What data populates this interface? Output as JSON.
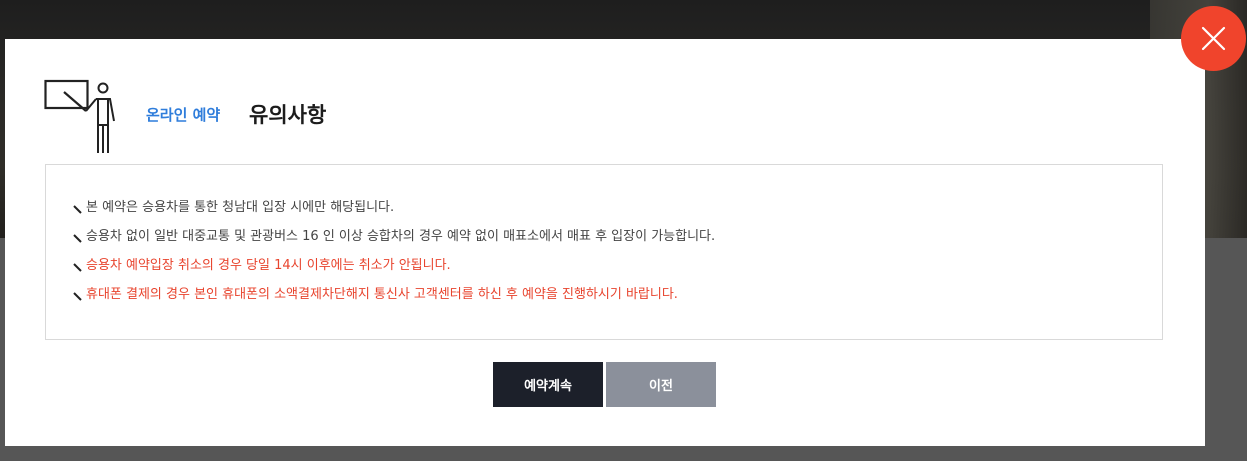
{
  "modal": {
    "title_sub": "온라인 예약",
    "title_main": "유의사항",
    "notices": [
      {
        "text": "본 예약은 승용차를 통한 청남대 입장 시에만 해당됩니다.",
        "highlight": false
      },
      {
        "text": "승용차 없이 일반 대중교통 및 관광버스 16 인 이상 승합차의 경우 예약 없이 매표소에서 매표 후 입장이 가능합니다.",
        "highlight": false
      },
      {
        "text": "승용차 예약입장 취소의 경우 당일 14시 이후에는 취소가 안됩니다.",
        "highlight": true
      },
      {
        "text": "휴대폰 결제의 경우 본인 휴대폰의 소액결제차단해지 통신사 고객센터를 하신 후 예약을 진행하시기 바랍니다.",
        "highlight": true
      }
    ],
    "buttons": {
      "continue_label": "예약계속",
      "prev_label": "이전"
    }
  },
  "icons": {
    "close": "close-icon",
    "presenter": "presenter-board-icon",
    "bullet": "diagonal-bullet-icon"
  },
  "colors": {
    "accent_blue": "#2f7ddb",
    "warning_red": "#e8442e",
    "close_red": "#f0442c",
    "primary_button": "#1c202a",
    "secondary_button": "#8b909b"
  }
}
